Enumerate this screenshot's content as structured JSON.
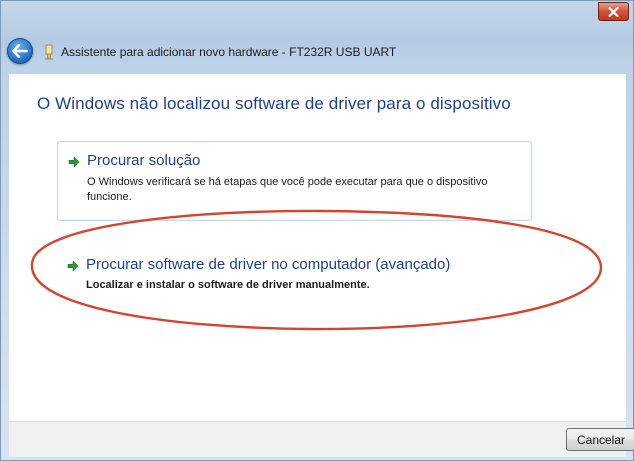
{
  "window": {
    "title": "Assistente para adicionar novo hardware - FT232R USB UART",
    "icons": {
      "back": "back-arrow-icon",
      "close": "close-icon",
      "wizard": "hardware-wizard-icon"
    }
  },
  "main": {
    "heading": "O Windows não localizou software de driver para o dispositivo",
    "options": [
      {
        "title": "Procurar solução",
        "description": "O Windows verificará se há etapas que você pode executar para que o dispositivo funcione.",
        "icon": "green-arrow-icon"
      },
      {
        "title": "Procurar software de driver no computador (avançado)",
        "description": "Localizar e instalar o software de driver manualmente.",
        "icon": "green-arrow-icon",
        "highlighted": true
      }
    ]
  },
  "footer": {
    "cancel_label": "Cancelar"
  },
  "colors": {
    "heading": "#1e3f91",
    "link": "#1e3f91",
    "highlight_ellipse": "#d7432d",
    "arrow": "#2c9a2c",
    "close_button": "#c9452b"
  }
}
